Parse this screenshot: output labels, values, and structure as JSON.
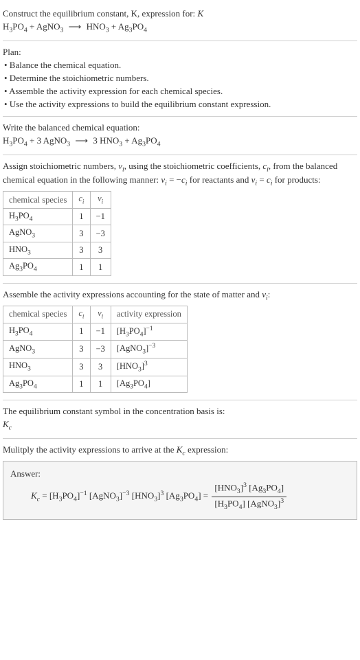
{
  "intro": {
    "title": "Construct the equilibrium constant, K, expression for:",
    "equation_lhs1": "H",
    "equation_lhs1_sub1": "3",
    "equation_lhs1_mid": "PO",
    "equation_lhs1_sub2": "4",
    "equation_plus1": " + AgNO",
    "equation_lhs2_sub": "3",
    "equation_rhs1": " HNO",
    "equation_rhs1_sub": "3",
    "equation_plus2": " + Ag",
    "equation_rhs2_sub1": "3",
    "equation_rhs2_mid": "PO",
    "equation_rhs2_sub2": "4"
  },
  "plan": {
    "heading": "Plan:",
    "b1": "• Balance the chemical equation.",
    "b2": "• Determine the stoichiometric numbers.",
    "b3": "• Assemble the activity expression for each chemical species.",
    "b4": "• Use the activity expressions to build the equilibrium constant expression."
  },
  "balanced": {
    "heading": "Write the balanced chemical equation:",
    "lhs1_a": "H",
    "lhs1_s1": "3",
    "lhs1_b": "PO",
    "lhs1_s2": "4",
    "plus1": " + 3 AgNO",
    "lhs2_s": "3",
    "rhs_pre": " 3 HNO",
    "rhs1_s": "3",
    "plus2": " + Ag",
    "rhs2_s1": "3",
    "rhs2_b": "PO",
    "rhs2_s2": "4"
  },
  "stoich": {
    "intro_a": "Assign stoichiometric numbers, ",
    "nu": "ν",
    "sub_i": "i",
    "intro_b": ", using the stoichiometric coefficients, ",
    "c": "c",
    "intro_c": ", from the balanced chemical equation in the following manner: ",
    "eq1": " = −",
    "intro_d": " for reactants and ",
    "eq2": " = ",
    "intro_e": " for products:",
    "table1": {
      "h1": "chemical species",
      "h2": "cᵢ",
      "h3": "νᵢ",
      "rows": [
        {
          "sp_a": "H",
          "sp_s1": "3",
          "sp_b": "PO",
          "sp_s2": "4",
          "c": "1",
          "v": "−1"
        },
        {
          "sp_a": "AgNO",
          "sp_s1": "3",
          "sp_b": "",
          "sp_s2": "",
          "c": "3",
          "v": "−3"
        },
        {
          "sp_a": "HNO",
          "sp_s1": "3",
          "sp_b": "",
          "sp_s2": "",
          "c": "3",
          "v": "3"
        },
        {
          "sp_a": "Ag",
          "sp_s1": "3",
          "sp_b": "PO",
          "sp_s2": "4",
          "c": "1",
          "v": "1"
        }
      ]
    }
  },
  "activity": {
    "intro": "Assemble the activity expressions accounting for the state of matter and ",
    "intro_end": ":",
    "table2": {
      "h1": "chemical species",
      "h2": "cᵢ",
      "h3": "νᵢ",
      "h4": "activity expression",
      "rows": [
        {
          "sp_a": "H",
          "sp_s1": "3",
          "sp_b": "PO",
          "sp_s2": "4",
          "c": "1",
          "v": "−1",
          "ae_a": "[H",
          "ae_s1": "3",
          "ae_b": "PO",
          "ae_s2": "4",
          "ae_c": "]",
          "ae_sup": "−1"
        },
        {
          "sp_a": "AgNO",
          "sp_s1": "3",
          "sp_b": "",
          "sp_s2": "",
          "c": "3",
          "v": "−3",
          "ae_a": "[AgNO",
          "ae_s1": "3",
          "ae_b": "",
          "ae_s2": "",
          "ae_c": "]",
          "ae_sup": "−3"
        },
        {
          "sp_a": "HNO",
          "sp_s1": "3",
          "sp_b": "",
          "sp_s2": "",
          "c": "3",
          "v": "3",
          "ae_a": "[HNO",
          "ae_s1": "3",
          "ae_b": "",
          "ae_s2": "",
          "ae_c": "]",
          "ae_sup": "3"
        },
        {
          "sp_a": "Ag",
          "sp_s1": "3",
          "sp_b": "PO",
          "sp_s2": "4",
          "c": "1",
          "v": "1",
          "ae_a": "[Ag",
          "ae_s1": "3",
          "ae_b": "PO",
          "ae_s2": "4",
          "ae_c": "]",
          "ae_sup": ""
        }
      ]
    }
  },
  "symbol": {
    "line1": "The equilibrium constant symbol in the concentration basis is:",
    "K": "K",
    "c": "c"
  },
  "final": {
    "intro_a": "Mulitply the activity expressions to arrive at the ",
    "intro_b": " expression:",
    "answer_label": "Answer:",
    "eq_lhs_K": "K",
    "eq_lhs_c": "c",
    "eq_eq": " = ",
    "term1_a": "[H",
    "term1_s1": "3",
    "term1_b": "PO",
    "term1_s2": "4",
    "term1_c": "]",
    "term1_sup": "−1",
    "term2_a": " [AgNO",
    "term2_s1": "3",
    "term2_c": "]",
    "term2_sup": "−3",
    "term3_a": " [HNO",
    "term3_s1": "3",
    "term3_c": "]",
    "term3_sup": "3",
    "term4_a": " [Ag",
    "term4_s1": "3",
    "term4_b": "PO",
    "term4_s2": "4",
    "term4_c": "] = ",
    "frac_top_a": "[HNO",
    "frac_top_s1": "3",
    "frac_top_b": "]",
    "frac_top_sup": "3",
    "frac_top_c": " [Ag",
    "frac_top_s2": "3",
    "frac_top_d": "PO",
    "frac_top_s3": "4",
    "frac_top_e": "]",
    "frac_bot_a": "[H",
    "frac_bot_s1": "3",
    "frac_bot_b": "PO",
    "frac_bot_s2": "4",
    "frac_bot_c": "] [AgNO",
    "frac_bot_s3": "3",
    "frac_bot_d": "]",
    "frac_bot_sup": "3"
  }
}
